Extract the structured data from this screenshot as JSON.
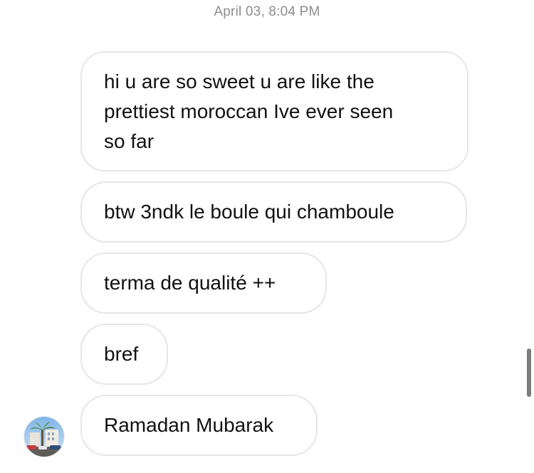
{
  "timestamp": "April 03, 8:04 PM",
  "messages": [
    {
      "lines": [
        "hi u are so sweet u are like the",
        "prettiest moroccan Ive ever seen",
        "so far"
      ]
    },
    {
      "lines": [
        "btw 3ndk le boule qui chamboule"
      ]
    },
    {
      "lines": [
        "terma de qualité ++"
      ]
    },
    {
      "lines": [
        "bref"
      ]
    },
    {
      "lines": [
        "Ramadan Mubarak"
      ]
    }
  ],
  "sender": {
    "avatar_icon": "profile-photo-avatar"
  },
  "colors": {
    "bubble_border": "#e6e6e6",
    "timestamp_text": "#8e8e8e",
    "message_text": "#111111"
  }
}
